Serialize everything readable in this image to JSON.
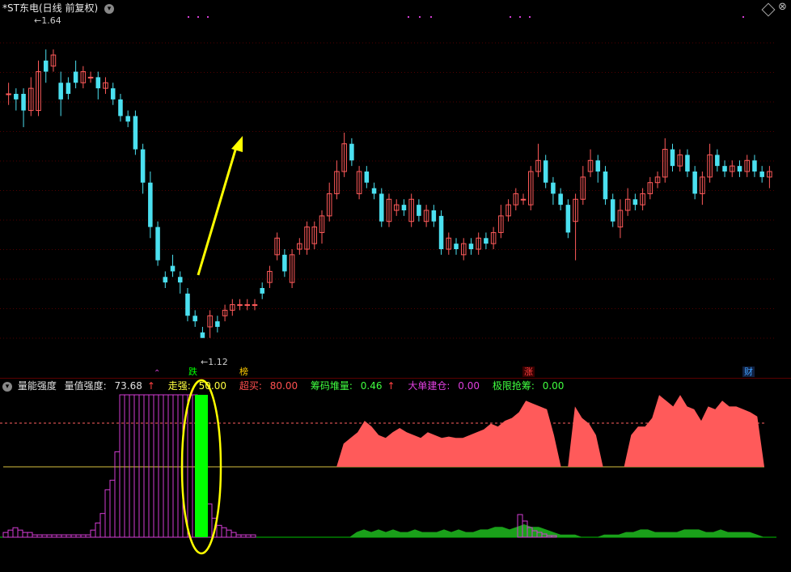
{
  "header": {
    "title": "*ST东电(日线 前复权)",
    "dropdown_icon": "chevron-down-icon"
  },
  "colors": {
    "up": "#ff5a5a",
    "down": "#4be0f0",
    "grid": "#500000",
    "magenta": "#d23cd2",
    "green": "#00e000",
    "yellow": "#ffff00",
    "pink_dash": "#ff6060"
  },
  "price_labels": {
    "high": "1.64",
    "low": "1.12"
  },
  "event_tags": [
    {
      "text": "跌",
      "color": "#00ff00"
    },
    {
      "text": "榜",
      "color": "#ffcc00"
    },
    {
      "text": "涨",
      "color": "#ff4040"
    },
    {
      "text": "财",
      "color": "#40a0ff"
    }
  ],
  "indicator": {
    "name": "量能强度",
    "items": [
      {
        "label": "量值强度:",
        "value": "73.68",
        "arrow": "↑",
        "color": "#e0e0e0"
      },
      {
        "label": "走强:",
        "value": "50.00",
        "arrow": "",
        "color": "#ffff40"
      },
      {
        "label": "超买:",
        "value": "80.00",
        "arrow": "",
        "color": "#ff5050"
      },
      {
        "label": "筹码堆量:",
        "value": "0.46",
        "arrow": "↑",
        "color": "#40ff40"
      },
      {
        "label": "大单建仓:",
        "value": "0.00",
        "arrow": "",
        "color": "#e040e0"
      },
      {
        "label": "极限抢筹:",
        "value": "0.00",
        "arrow": "",
        "color": "#40ff40"
      }
    ]
  },
  "chart_data": {
    "type": "candlestick",
    "title": "*ST东电(日线 前复权)",
    "ylim": [
      1.07,
      1.7
    ],
    "y_high_label": 1.64,
    "y_low_label": 1.12,
    "candles": [
      [
        1.56,
        1.56,
        1.58,
        1.54
      ],
      [
        1.56,
        1.55,
        1.57,
        1.53
      ],
      [
        1.56,
        1.53,
        1.57,
        1.5
      ],
      [
        1.53,
        1.57,
        1.59,
        1.52
      ],
      [
        1.53,
        1.6,
        1.62,
        1.52
      ],
      [
        1.62,
        1.6,
        1.64,
        1.58
      ],
      [
        1.61,
        1.63,
        1.64,
        1.6
      ],
      [
        1.58,
        1.55,
        1.6,
        1.52
      ],
      [
        1.58,
        1.56,
        1.59,
        1.55
      ],
      [
        1.6,
        1.58,
        1.62,
        1.57
      ],
      [
        1.58,
        1.6,
        1.61,
        1.57
      ],
      [
        1.59,
        1.59,
        1.6,
        1.58
      ],
      [
        1.59,
        1.57,
        1.6,
        1.55
      ],
      [
        1.57,
        1.58,
        1.59,
        1.56
      ],
      [
        1.57,
        1.55,
        1.58,
        1.54
      ],
      [
        1.55,
        1.52,
        1.56,
        1.51
      ],
      [
        1.52,
        1.51,
        1.53,
        1.5
      ],
      [
        1.52,
        1.46,
        1.53,
        1.45
      ],
      [
        1.46,
        1.4,
        1.47,
        1.38
      ],
      [
        1.4,
        1.32,
        1.42,
        1.3
      ],
      [
        1.32,
        1.26,
        1.33,
        1.25
      ],
      [
        1.23,
        1.22,
        1.24,
        1.21
      ],
      [
        1.25,
        1.24,
        1.27,
        1.23
      ],
      [
        1.23,
        1.22,
        1.24,
        1.2
      ],
      [
        1.2,
        1.16,
        1.21,
        1.15
      ],
      [
        1.16,
        1.15,
        1.17,
        1.14
      ],
      [
        1.13,
        1.12,
        1.14,
        1.12
      ],
      [
        1.14,
        1.16,
        1.17,
        1.12
      ],
      [
        1.15,
        1.14,
        1.16,
        1.13
      ],
      [
        1.16,
        1.17,
        1.18,
        1.15
      ],
      [
        1.17,
        1.18,
        1.19,
        1.16
      ],
      [
        1.18,
        1.18,
        1.19,
        1.17
      ],
      [
        1.18,
        1.18,
        1.19,
        1.17
      ],
      [
        1.18,
        1.18,
        1.19,
        1.17
      ],
      [
        1.21,
        1.2,
        1.22,
        1.19
      ],
      [
        1.22,
        1.24,
        1.25,
        1.21
      ],
      [
        1.27,
        1.3,
        1.31,
        1.26
      ],
      [
        1.27,
        1.24,
        1.28,
        1.23
      ],
      [
        1.22,
        1.27,
        1.28,
        1.21
      ],
      [
        1.28,
        1.29,
        1.3,
        1.27
      ],
      [
        1.28,
        1.32,
        1.33,
        1.27
      ],
      [
        1.29,
        1.32,
        1.33,
        1.28
      ],
      [
        1.31,
        1.34,
        1.35,
        1.29
      ],
      [
        1.34,
        1.38,
        1.4,
        1.33
      ],
      [
        1.38,
        1.42,
        1.44,
        1.37
      ],
      [
        1.42,
        1.47,
        1.49,
        1.41
      ],
      [
        1.47,
        1.44,
        1.48,
        1.43
      ],
      [
        1.38,
        1.42,
        1.43,
        1.37
      ],
      [
        1.42,
        1.4,
        1.43,
        1.39
      ],
      [
        1.39,
        1.38,
        1.4,
        1.37
      ],
      [
        1.38,
        1.33,
        1.39,
        1.32
      ],
      [
        1.33,
        1.37,
        1.38,
        1.32
      ],
      [
        1.35,
        1.36,
        1.37,
        1.34
      ],
      [
        1.36,
        1.35,
        1.37,
        1.34
      ],
      [
        1.33,
        1.37,
        1.38,
        1.32
      ],
      [
        1.36,
        1.34,
        1.37,
        1.33
      ],
      [
        1.33,
        1.35,
        1.36,
        1.32
      ],
      [
        1.35,
        1.33,
        1.36,
        1.32
      ],
      [
        1.34,
        1.28,
        1.35,
        1.27
      ],
      [
        1.28,
        1.3,
        1.31,
        1.27
      ],
      [
        1.29,
        1.28,
        1.3,
        1.27
      ],
      [
        1.27,
        1.29,
        1.3,
        1.26
      ],
      [
        1.29,
        1.28,
        1.3,
        1.27
      ],
      [
        1.28,
        1.3,
        1.31,
        1.27
      ],
      [
        1.3,
        1.29,
        1.31,
        1.28
      ],
      [
        1.29,
        1.31,
        1.32,
        1.28
      ],
      [
        1.31,
        1.34,
        1.36,
        1.3
      ],
      [
        1.34,
        1.36,
        1.37,
        1.33
      ],
      [
        1.36,
        1.38,
        1.39,
        1.35
      ],
      [
        1.37,
        1.37,
        1.38,
        1.36
      ],
      [
        1.36,
        1.42,
        1.43,
        1.35
      ],
      [
        1.42,
        1.44,
        1.47,
        1.41
      ],
      [
        1.44,
        1.4,
        1.45,
        1.39
      ],
      [
        1.4,
        1.38,
        1.41,
        1.36
      ],
      [
        1.38,
        1.36,
        1.39,
        1.35
      ],
      [
        1.36,
        1.31,
        1.37,
        1.3
      ],
      [
        1.33,
        1.37,
        1.38,
        1.26
      ],
      [
        1.37,
        1.41,
        1.43,
        1.36
      ],
      [
        1.42,
        1.44,
        1.46,
        1.41
      ],
      [
        1.44,
        1.42,
        1.45,
        1.4
      ],
      [
        1.42,
        1.37,
        1.43,
        1.36
      ],
      [
        1.37,
        1.33,
        1.38,
        1.32
      ],
      [
        1.32,
        1.35,
        1.37,
        1.3
      ],
      [
        1.35,
        1.37,
        1.39,
        1.34
      ],
      [
        1.37,
        1.36,
        1.38,
        1.35
      ],
      [
        1.36,
        1.38,
        1.39,
        1.35
      ],
      [
        1.38,
        1.4,
        1.41,
        1.37
      ],
      [
        1.4,
        1.41,
        1.42,
        1.39
      ],
      [
        1.41,
        1.46,
        1.48,
        1.4
      ],
      [
        1.46,
        1.43,
        1.47,
        1.42
      ],
      [
        1.43,
        1.45,
        1.46,
        1.42
      ],
      [
        1.45,
        1.42,
        1.46,
        1.41
      ],
      [
        1.42,
        1.38,
        1.43,
        1.37
      ],
      [
        1.38,
        1.41,
        1.42,
        1.36
      ],
      [
        1.41,
        1.45,
        1.47,
        1.4
      ],
      [
        1.45,
        1.43,
        1.46,
        1.42
      ],
      [
        1.43,
        1.42,
        1.44,
        1.41
      ],
      [
        1.42,
        1.43,
        1.44,
        1.41
      ],
      [
        1.43,
        1.42,
        1.44,
        1.41
      ],
      [
        1.42,
        1.44,
        1.45,
        1.41
      ],
      [
        1.44,
        1.42,
        1.45,
        1.41
      ],
      [
        1.42,
        1.41,
        1.43,
        1.4
      ],
      [
        1.41,
        1.42,
        1.43,
        1.39
      ]
    ],
    "pane2": {
      "name": "量能强度",
      "ylim": [
        0,
        100
      ],
      "levels": {
        "走强": 50,
        "超买": 80
      },
      "strength_area": [
        0,
        0,
        0,
        0,
        0,
        0,
        0,
        0,
        0,
        0,
        0,
        0,
        0,
        0,
        0,
        0,
        0,
        0,
        0,
        0,
        0,
        0,
        0,
        0,
        0,
        0,
        0,
        0,
        0,
        0,
        0,
        0,
        0,
        0,
        0,
        0,
        0,
        0,
        0,
        0,
        0,
        0,
        0,
        0,
        0,
        0,
        0,
        0,
        0,
        54,
        58,
        62,
        70,
        66,
        60,
        58,
        62,
        65,
        62,
        60,
        58,
        62,
        60,
        58,
        59,
        58,
        58,
        60,
        62,
        64,
        68,
        66,
        70,
        72,
        76,
        84,
        82,
        80,
        78,
        60,
        50,
        50,
        80,
        72,
        68,
        60,
        50,
        50,
        50,
        50,
        60,
        66,
        66,
        72,
        88,
        84,
        80,
        88,
        80,
        78,
        70,
        80,
        78,
        84,
        80,
        80,
        78,
        76,
        73
      ],
      "cap_bars": [
        2,
        3,
        4,
        3,
        2,
        2,
        1,
        1,
        1,
        1,
        1,
        1,
        1,
        1,
        1,
        1,
        1,
        1,
        3,
        6,
        10,
        20,
        24,
        36,
        60,
        60,
        60,
        60,
        60,
        60,
        60,
        60,
        60,
        60,
        60,
        60,
        60,
        60,
        60,
        60,
        50,
        24,
        14,
        8,
        5,
        4,
        3,
        2,
        1,
        1,
        1,
        1
      ],
      "green_area": [
        0,
        0,
        0,
        0,
        0,
        0,
        0,
        0,
        0,
        0,
        0,
        0,
        0,
        0,
        0,
        0,
        0,
        0,
        0,
        0,
        0,
        0,
        0,
        0,
        0,
        0,
        0,
        0,
        0,
        0,
        0,
        0,
        0,
        0,
        0,
        0,
        0,
        0,
        0,
        0,
        0,
        0,
        0,
        0,
        0,
        0,
        0,
        0,
        0,
        2,
        3,
        2,
        3,
        2,
        3,
        2,
        2,
        3,
        2,
        2,
        2,
        3,
        2,
        3,
        2,
        2,
        3,
        3,
        4,
        4,
        3,
        4,
        5,
        4,
        4,
        3,
        2,
        1,
        1,
        1,
        0,
        0,
        0,
        1,
        1,
        1,
        2,
        2,
        3,
        3,
        2,
        2,
        2,
        2,
        3,
        3,
        3,
        2,
        2,
        3,
        2,
        2,
        2,
        2,
        1
      ]
    }
  }
}
